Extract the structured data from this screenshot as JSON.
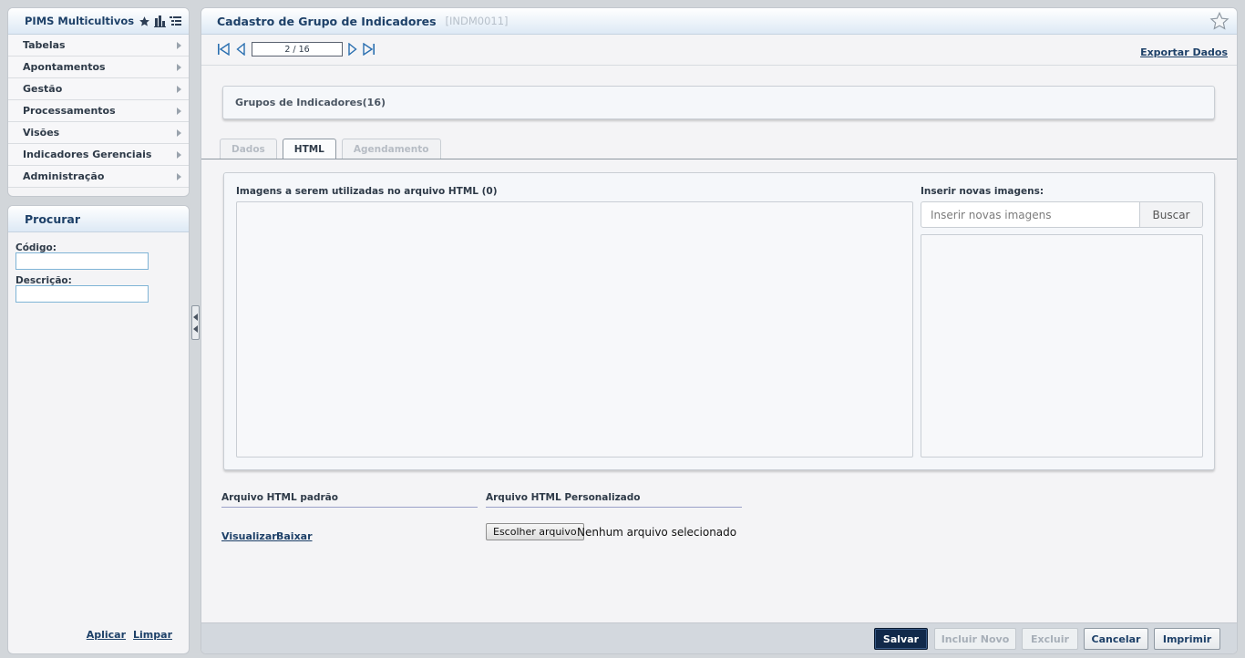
{
  "app": {
    "title": "PIMS Multicultivos",
    "header_icons": [
      "star-icon",
      "bar-chart-icon",
      "list-icon"
    ]
  },
  "menu": {
    "items": [
      {
        "label": "Tabelas"
      },
      {
        "label": "Apontamentos"
      },
      {
        "label": "Gestão"
      },
      {
        "label": "Processamentos"
      },
      {
        "label": "Visões"
      },
      {
        "label": "Indicadores Gerenciais"
      },
      {
        "label": "Administração"
      }
    ]
  },
  "search": {
    "title": "Procurar",
    "code_label": "Código:",
    "code_value": "",
    "description_label": "Descrição:",
    "description_value": "",
    "apply_label": "Aplicar",
    "clear_label": "Limpar"
  },
  "page": {
    "title": "Cadastro de Grupo de Indicadores",
    "code": "[INDM0011]"
  },
  "pager": {
    "value": "2 / 16",
    "export_label": "Exportar Dados"
  },
  "group": {
    "label": "Grupos de Indicadores(16)"
  },
  "tabs": [
    {
      "label": "Dados",
      "active": false
    },
    {
      "label": "HTML",
      "active": true
    },
    {
      "label": "Agendamento",
      "active": false
    }
  ],
  "html_tab": {
    "images_label": "Imagens a serem utilizadas no arquivo HTML (0)",
    "insert_label": "Inserir novas imagens:",
    "insert_placeholder": "Inserir novas imagens",
    "search_button": "Buscar",
    "default_file_label": "Arquivo HTML padrão",
    "view_label": "Visualizar",
    "download_label": "Baixar",
    "custom_file_label": "Arquivo HTML Personalizado",
    "choose_file_label": "Escolher arquivo",
    "no_file_label": "Nenhum arquivo selecionado"
  },
  "footer": {
    "save": "Salvar",
    "add_new": "Incluir Novo",
    "delete": "Excluir",
    "cancel": "Cancelar",
    "print": "Imprimir"
  },
  "colors": {
    "primary_button": "#11294a",
    "heading": "#1d4068",
    "input_border": "#7fb4d6"
  }
}
